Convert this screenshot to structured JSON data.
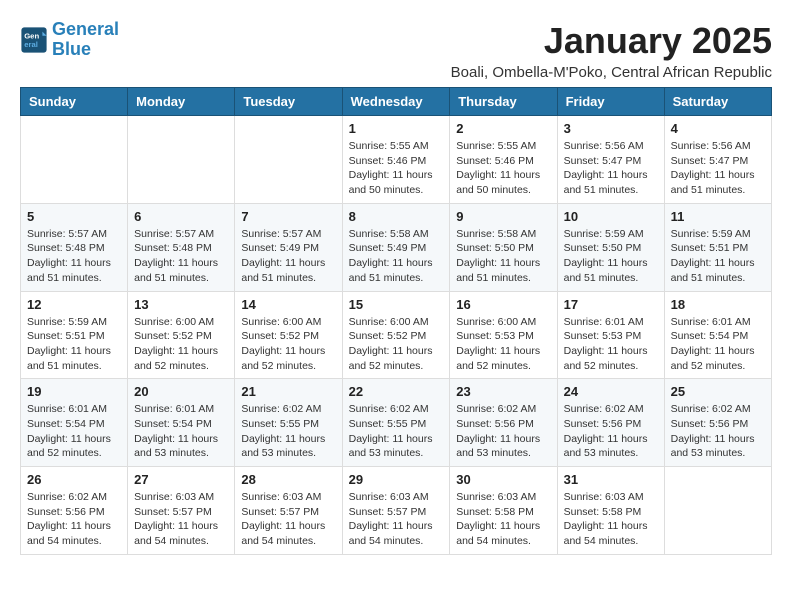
{
  "header": {
    "logo_line1": "General",
    "logo_line2": "Blue",
    "title": "January 2025",
    "subtitle": "Boali, Ombella-M'Poko, Central African Republic"
  },
  "weekdays": [
    "Sunday",
    "Monday",
    "Tuesday",
    "Wednesday",
    "Thursday",
    "Friday",
    "Saturday"
  ],
  "weeks": [
    [
      {
        "day": "",
        "info": ""
      },
      {
        "day": "",
        "info": ""
      },
      {
        "day": "",
        "info": ""
      },
      {
        "day": "1",
        "info": "Sunrise: 5:55 AM\nSunset: 5:46 PM\nDaylight: 11 hours and 50 minutes."
      },
      {
        "day": "2",
        "info": "Sunrise: 5:55 AM\nSunset: 5:46 PM\nDaylight: 11 hours and 50 minutes."
      },
      {
        "day": "3",
        "info": "Sunrise: 5:56 AM\nSunset: 5:47 PM\nDaylight: 11 hours and 51 minutes."
      },
      {
        "day": "4",
        "info": "Sunrise: 5:56 AM\nSunset: 5:47 PM\nDaylight: 11 hours and 51 minutes."
      }
    ],
    [
      {
        "day": "5",
        "info": "Sunrise: 5:57 AM\nSunset: 5:48 PM\nDaylight: 11 hours and 51 minutes."
      },
      {
        "day": "6",
        "info": "Sunrise: 5:57 AM\nSunset: 5:48 PM\nDaylight: 11 hours and 51 minutes."
      },
      {
        "day": "7",
        "info": "Sunrise: 5:57 AM\nSunset: 5:49 PM\nDaylight: 11 hours and 51 minutes."
      },
      {
        "day": "8",
        "info": "Sunrise: 5:58 AM\nSunset: 5:49 PM\nDaylight: 11 hours and 51 minutes."
      },
      {
        "day": "9",
        "info": "Sunrise: 5:58 AM\nSunset: 5:50 PM\nDaylight: 11 hours and 51 minutes."
      },
      {
        "day": "10",
        "info": "Sunrise: 5:59 AM\nSunset: 5:50 PM\nDaylight: 11 hours and 51 minutes."
      },
      {
        "day": "11",
        "info": "Sunrise: 5:59 AM\nSunset: 5:51 PM\nDaylight: 11 hours and 51 minutes."
      }
    ],
    [
      {
        "day": "12",
        "info": "Sunrise: 5:59 AM\nSunset: 5:51 PM\nDaylight: 11 hours and 51 minutes."
      },
      {
        "day": "13",
        "info": "Sunrise: 6:00 AM\nSunset: 5:52 PM\nDaylight: 11 hours and 52 minutes."
      },
      {
        "day": "14",
        "info": "Sunrise: 6:00 AM\nSunset: 5:52 PM\nDaylight: 11 hours and 52 minutes."
      },
      {
        "day": "15",
        "info": "Sunrise: 6:00 AM\nSunset: 5:52 PM\nDaylight: 11 hours and 52 minutes."
      },
      {
        "day": "16",
        "info": "Sunrise: 6:00 AM\nSunset: 5:53 PM\nDaylight: 11 hours and 52 minutes."
      },
      {
        "day": "17",
        "info": "Sunrise: 6:01 AM\nSunset: 5:53 PM\nDaylight: 11 hours and 52 minutes."
      },
      {
        "day": "18",
        "info": "Sunrise: 6:01 AM\nSunset: 5:54 PM\nDaylight: 11 hours and 52 minutes."
      }
    ],
    [
      {
        "day": "19",
        "info": "Sunrise: 6:01 AM\nSunset: 5:54 PM\nDaylight: 11 hours and 52 minutes."
      },
      {
        "day": "20",
        "info": "Sunrise: 6:01 AM\nSunset: 5:54 PM\nDaylight: 11 hours and 53 minutes."
      },
      {
        "day": "21",
        "info": "Sunrise: 6:02 AM\nSunset: 5:55 PM\nDaylight: 11 hours and 53 minutes."
      },
      {
        "day": "22",
        "info": "Sunrise: 6:02 AM\nSunset: 5:55 PM\nDaylight: 11 hours and 53 minutes."
      },
      {
        "day": "23",
        "info": "Sunrise: 6:02 AM\nSunset: 5:56 PM\nDaylight: 11 hours and 53 minutes."
      },
      {
        "day": "24",
        "info": "Sunrise: 6:02 AM\nSunset: 5:56 PM\nDaylight: 11 hours and 53 minutes."
      },
      {
        "day": "25",
        "info": "Sunrise: 6:02 AM\nSunset: 5:56 PM\nDaylight: 11 hours and 53 minutes."
      }
    ],
    [
      {
        "day": "26",
        "info": "Sunrise: 6:02 AM\nSunset: 5:56 PM\nDaylight: 11 hours and 54 minutes."
      },
      {
        "day": "27",
        "info": "Sunrise: 6:03 AM\nSunset: 5:57 PM\nDaylight: 11 hours and 54 minutes."
      },
      {
        "day": "28",
        "info": "Sunrise: 6:03 AM\nSunset: 5:57 PM\nDaylight: 11 hours and 54 minutes."
      },
      {
        "day": "29",
        "info": "Sunrise: 6:03 AM\nSunset: 5:57 PM\nDaylight: 11 hours and 54 minutes."
      },
      {
        "day": "30",
        "info": "Sunrise: 6:03 AM\nSunset: 5:58 PM\nDaylight: 11 hours and 54 minutes."
      },
      {
        "day": "31",
        "info": "Sunrise: 6:03 AM\nSunset: 5:58 PM\nDaylight: 11 hours and 54 minutes."
      },
      {
        "day": "",
        "info": ""
      }
    ]
  ]
}
